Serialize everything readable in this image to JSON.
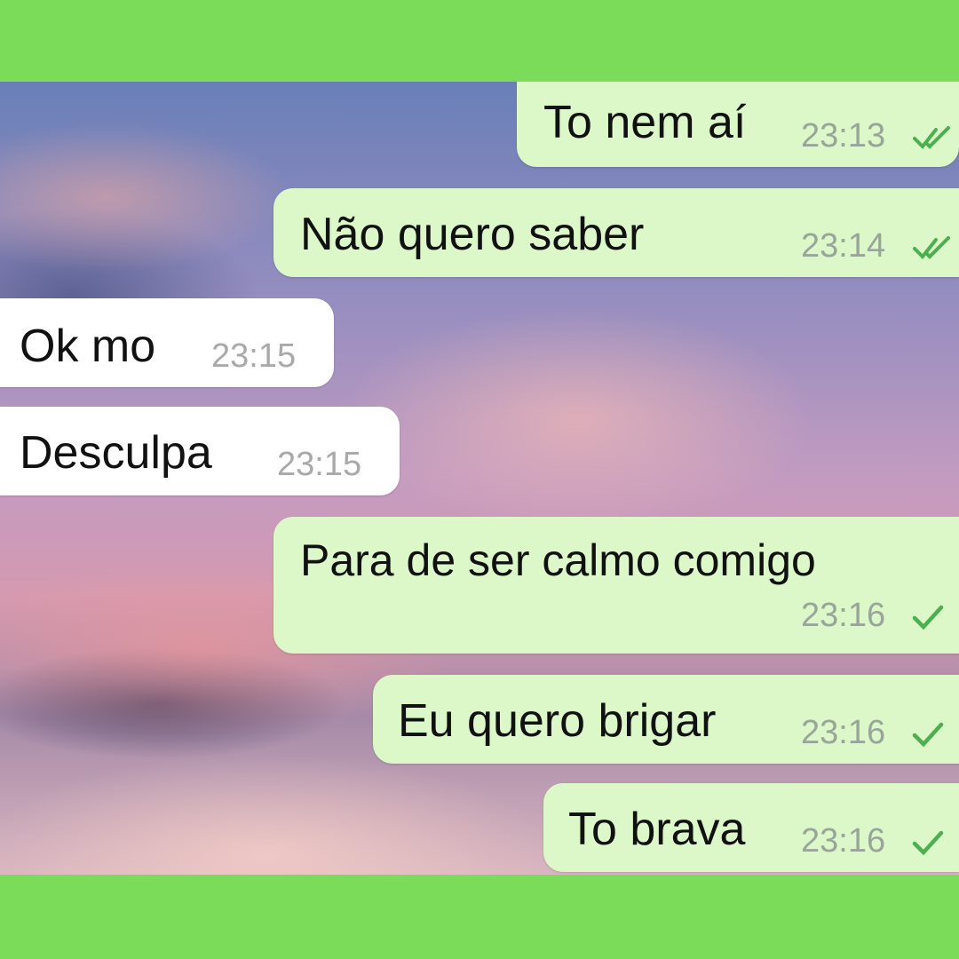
{
  "messages": [
    {
      "text": "To nem aí",
      "time": "23:13",
      "direction": "outgoing",
      "status_icon": "double-check-icon"
    },
    {
      "text": "Não quero saber",
      "time": "23:14",
      "direction": "outgoing",
      "status_icon": "double-check-icon"
    },
    {
      "text": "Ok mo",
      "time": "23:15",
      "direction": "incoming"
    },
    {
      "text": "Desculpa",
      "time": "23:15",
      "direction": "incoming"
    },
    {
      "text": "Para de ser calmo comigo",
      "time": "23:16",
      "direction": "outgoing",
      "status_icon": "check-icon"
    },
    {
      "text": "Eu quero brigar",
      "time": "23:16",
      "direction": "outgoing",
      "status_icon": "check-icon"
    },
    {
      "text": "To brava",
      "time": "23:16",
      "direction": "outgoing",
      "status_icon": "check-icon"
    }
  ],
  "colors": {
    "frame": "#7bdc5a",
    "outgoing_bubble": "#dcf7c8",
    "incoming_bubble": "#ffffff",
    "tick": "#4caf50"
  }
}
